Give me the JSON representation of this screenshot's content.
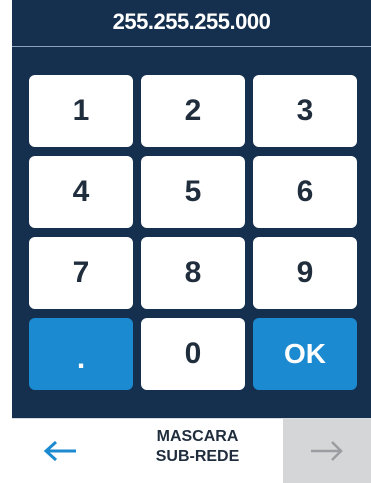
{
  "display": {
    "value": "255.255.255.000"
  },
  "keypad": {
    "keys": [
      "1",
      "2",
      "3",
      "4",
      "5",
      "6",
      "7",
      "8",
      "9",
      ".",
      "0",
      "OK"
    ]
  },
  "footer": {
    "label_line1": "MASCARA",
    "label_line2": "SUB-REDE",
    "back_icon": "arrow-left-icon",
    "next_icon": "arrow-right-icon"
  },
  "colors": {
    "panel": "#15304f",
    "accent": "#1b8ad0",
    "key": "#ffffff",
    "disabled": "#d5d6d8"
  }
}
